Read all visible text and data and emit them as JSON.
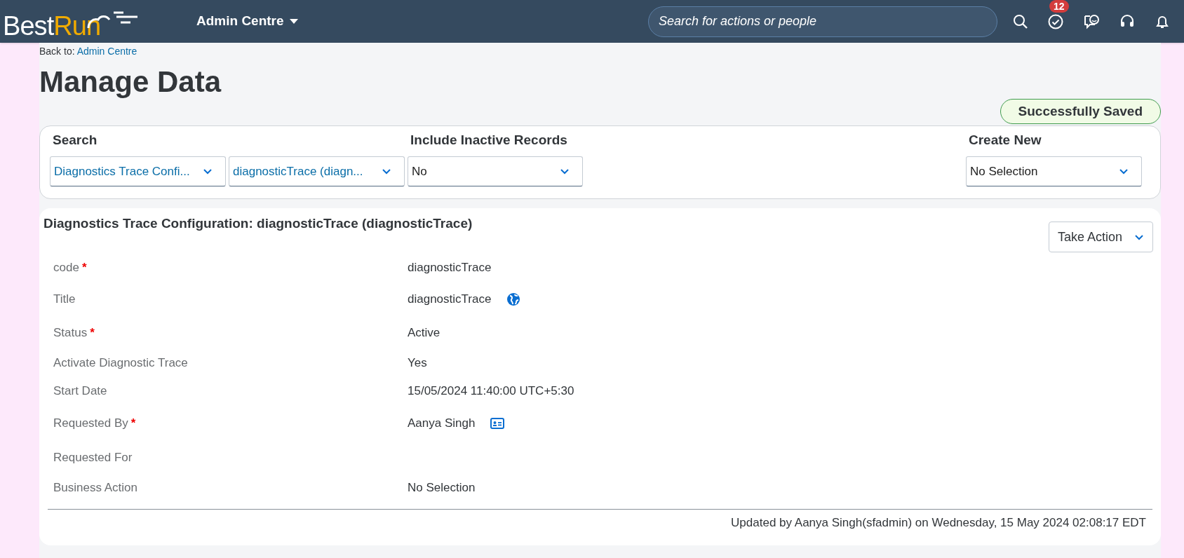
{
  "header": {
    "logo": [
      "Best",
      "Run"
    ],
    "menu": "Admin Centre",
    "search": {
      "placeholder": "Search for actions or people"
    },
    "badge": "12"
  },
  "breadcrumb": {
    "prefix": "Back to:",
    "link": "Admin Centre"
  },
  "title": "Manage Data",
  "toast": "Successfully Saved",
  "filters": {
    "search_label": "Search",
    "inactive_label": "Include Inactive Records",
    "create_label": "Create New",
    "search_values": [
      "Diagnostics Trace Confi...",
      "diagnosticTrace (diagn..."
    ],
    "inactive_value": "No",
    "create_value": "No Selection"
  },
  "record": {
    "heading": "Diagnostics Trace Configuration: diagnosticTrace (diagnosticTrace)",
    "action": "Take Action",
    "fields": [
      {
        "label": "code",
        "required_mark": "*",
        "value": "diagnosticTrace"
      },
      {
        "label": "Title",
        "value": "diagnosticTrace",
        "kind": "globe"
      },
      {
        "label": "Status",
        "required_mark": "*",
        "value": "Active"
      },
      {
        "label": "Activate Diagnostic Trace",
        "value": "Yes"
      },
      {
        "label": "Start Date",
        "value": "15/05/2024 11:40:00 UTC+5:30"
      },
      {
        "label": "Requested By",
        "required_mark": "*",
        "value": "Aanya Singh",
        "kind": "contact-card"
      },
      {
        "label": "Requested For"
      },
      {
        "label": "Business Action",
        "value": "No Selection"
      }
    ],
    "footer": "Updated by Aanya Singh(sfadmin) on Wednesday, 15 May 2024 02:08:17 EDT"
  }
}
